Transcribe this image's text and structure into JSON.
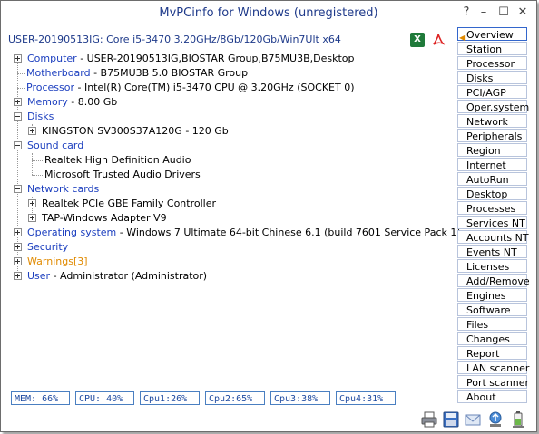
{
  "window": {
    "title": "MvPCinfo for Windows (unregistered)",
    "help": "?",
    "minimize": "–",
    "maximize": "☐",
    "close": "✕"
  },
  "summary": "USER-20190513IG: Core i5-3470 3.20GHz/8Gb/120Gb/Win7Ult x64",
  "export": {
    "excel": "X",
    "pdf": "⤓"
  },
  "tree": {
    "computer": {
      "label": "Computer",
      "value": "- USER-20190513IG,BIOSTAR Group,B75MU3B,Desktop"
    },
    "motherboard": {
      "label": "Motherboard",
      "value": "- B75MU3B 5.0 BIOSTAR Group"
    },
    "processor": {
      "label": "Processor",
      "value": "- Intel(R) Core(TM) i5-3470 CPU @ 3.20GHz (SOCKET 0)"
    },
    "memory": {
      "label": "Memory",
      "value": "- 8.00 Gb"
    },
    "disks": {
      "label": "Disks"
    },
    "disk1": "KINGSTON SV300S37A120G - 120 Gb",
    "sound": {
      "label": "Sound card"
    },
    "sound1": "Realtek High Definition Audio",
    "sound2": "Microsoft Trusted Audio Drivers",
    "network": {
      "label": "Network cards"
    },
    "net1": "Realtek PCIe GBE Family Controller",
    "net2": "TAP-Windows Adapter V9",
    "os": {
      "label": "Operating system",
      "value": "- Windows 7 Ultimate 64-bit Chinese 6.1 (build 7601 Service Pack 1)"
    },
    "security": {
      "label": "Security"
    },
    "warnings": {
      "label": "Warnings[3]"
    },
    "user": {
      "label": "User",
      "value": "- Administrator (Administrator)"
    }
  },
  "sidebar": {
    "items": [
      "Overview",
      "Station",
      "Processor",
      "Disks",
      "PCI/AGP",
      "Oper.system",
      "Network",
      "Peripherals",
      "Region",
      "Internet",
      "AutoRun",
      "Desktop",
      "Processes",
      "Services NT",
      "Accounts NT",
      "Events NT",
      "Licenses",
      "Add/Remove",
      "Engines",
      "Software",
      "Files",
      "Changes",
      "Report",
      "LAN scanner",
      "Port scanner",
      "About"
    ],
    "active": "Overview"
  },
  "status": {
    "mem": "MEM: 66%",
    "cpu": "CPU: 40%",
    "cpu1": "Cpu1:26%",
    "cpu2": "Cpu2:65%",
    "cpu3": "Cpu3:38%",
    "cpu4": "Cpu4:31%"
  },
  "colors": {
    "category": "#1c3fbf",
    "warning": "#e08a00",
    "title": "#1f3a8a",
    "status_border": "#4a7fc1"
  },
  "icons": [
    "printer-icon",
    "save-icon",
    "email-icon",
    "upload-icon",
    "battery-icon"
  ]
}
